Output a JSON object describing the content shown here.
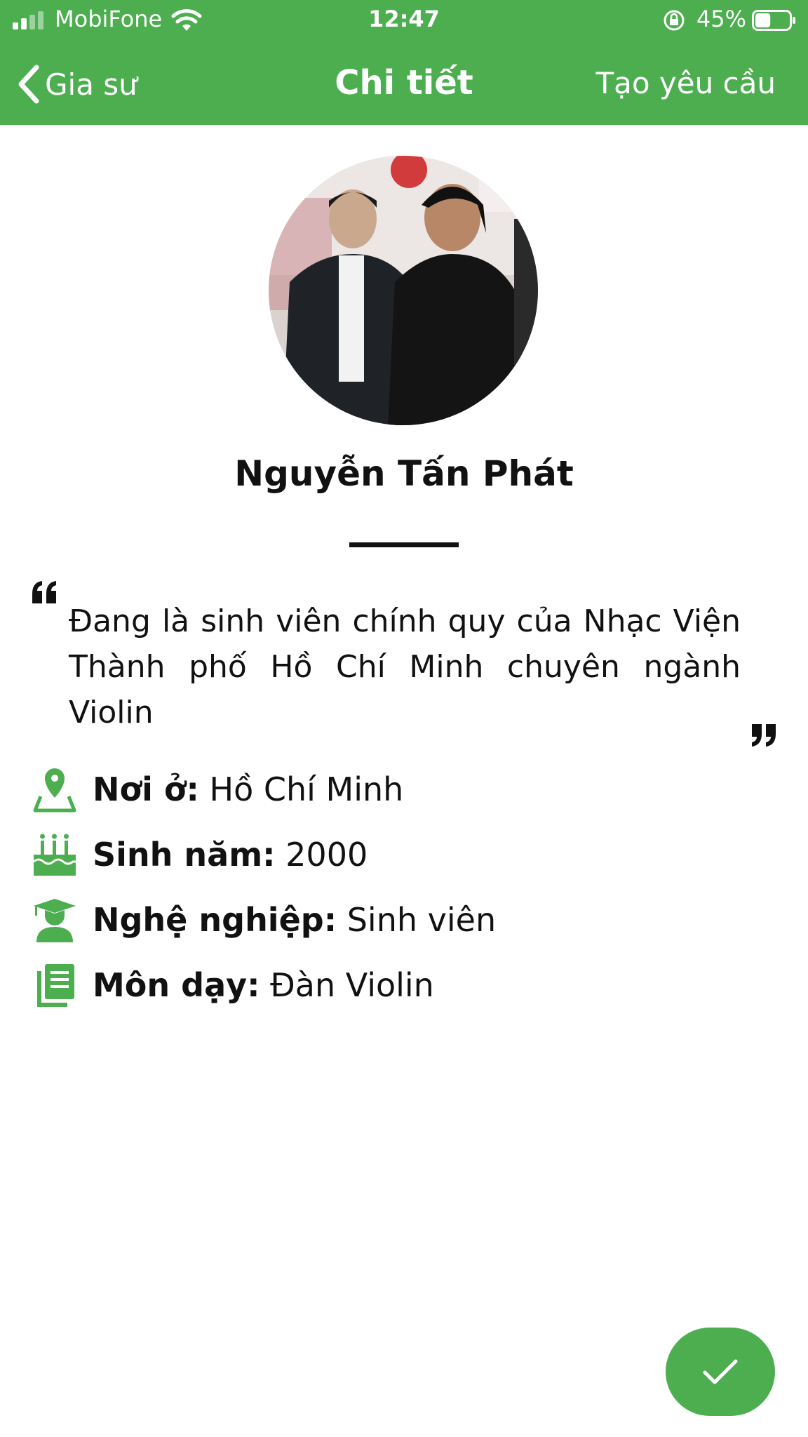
{
  "status_bar": {
    "carrier": "MobiFone",
    "time": "12:47",
    "battery_percent": "45%",
    "battery_level": 0.45,
    "signal_bars": 2
  },
  "nav": {
    "back_label": "Gia sư",
    "title": "Chi tiết",
    "action_label": "Tạo yêu cầu"
  },
  "profile": {
    "name": "Nguyễn Tấn Phát",
    "bio": "Đang là sinh viên chính quy của Nhạc Viện Thành phố Hồ Chí Minh chuyên ngành Violin",
    "details": [
      {
        "icon": "location-pin-icon",
        "label": "Nơi ở:",
        "value": "Hồ Chí Minh"
      },
      {
        "icon": "birthday-cake-icon",
        "label": "Sinh năm:",
        "value": "2000"
      },
      {
        "icon": "graduate-icon",
        "label": "Nghệ nghiệp:",
        "value": "Sinh viên"
      },
      {
        "icon": "subject-book-icon",
        "label": "Môn dạy:",
        "value": "Đàn Violin"
      }
    ]
  },
  "colors": {
    "brand_green": "#4cae4f",
    "text": "#111111"
  },
  "fab": {
    "icon": "checkmark-icon"
  }
}
